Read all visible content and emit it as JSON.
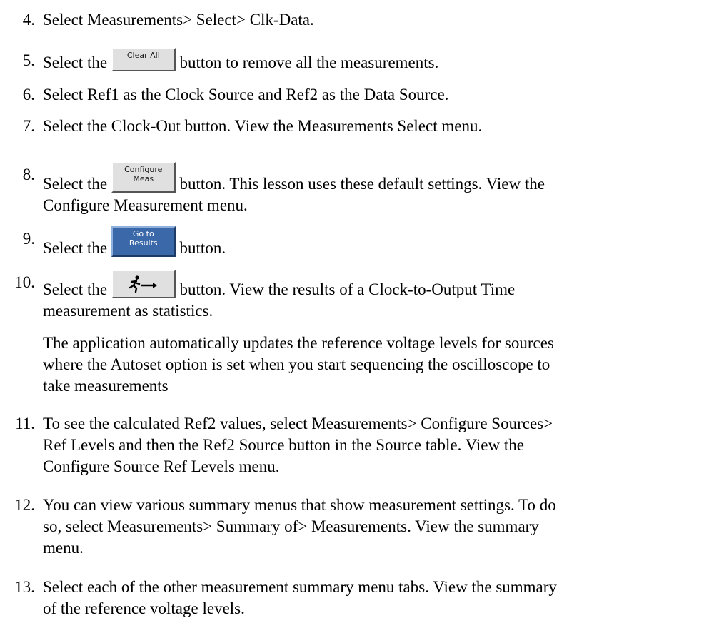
{
  "steps": [
    {
      "num": "4.",
      "line1": "Select Measurements> Select> Clk-Data."
    },
    {
      "num": "5.",
      "before": "Select the",
      "button": "Clear All",
      "after": "button to remove all the measurements."
    },
    {
      "num": "6.",
      "line1": "Select Ref1 as the Clock Source and Ref2 as the Data Source."
    },
    {
      "num": "7.",
      "line1": "Select the Clock-Out button. View the Measurements Select menu."
    },
    {
      "num": "8.",
      "before": "Select the",
      "button_top": "Configure",
      "button_bottom": "Meas",
      "after": "button. This lesson uses these default settings. View the",
      "line2": "Configure Measurement menu."
    },
    {
      "num": "9.",
      "before": "Select the",
      "button_top": "Go to",
      "button_bottom": "Results",
      "after": "button."
    },
    {
      "num": "10.",
      "before": "Select the",
      "button_icon": "run-sequence-icon",
      "after": "button. View the results of a Clock-to-Output Time",
      "line2": "measurement as statistics."
    },
    {
      "num": "11.",
      "line1": "To see the calculated Ref2 values, select Measurements> Configure Sources>",
      "line2": "Ref Levels and then the Ref2 Source button in the Source table. View the",
      "line3": "Configure Source Ref Levels menu."
    },
    {
      "num": "12.",
      "line1": "You can view various summary menus that show measurement settings. To do",
      "line2": "so, select Measurements> Summary of> Measurements. View the summary",
      "line3": "menu."
    },
    {
      "num": "13.",
      "line1": "Select each of the other measurement summary menu tabs. View the summary",
      "line2": "of the reference voltage levels."
    }
  ],
  "note": {
    "line1": "The application automatically updates the reference voltage levels for sources",
    "line2": "where the Autoset option is set when you start sequencing the oscilloscope to",
    "line3": "take measurements"
  },
  "colors": {
    "text": "#000000",
    "button_blue": "#3a68a8",
    "button_gray": "#e0e0e0"
  }
}
